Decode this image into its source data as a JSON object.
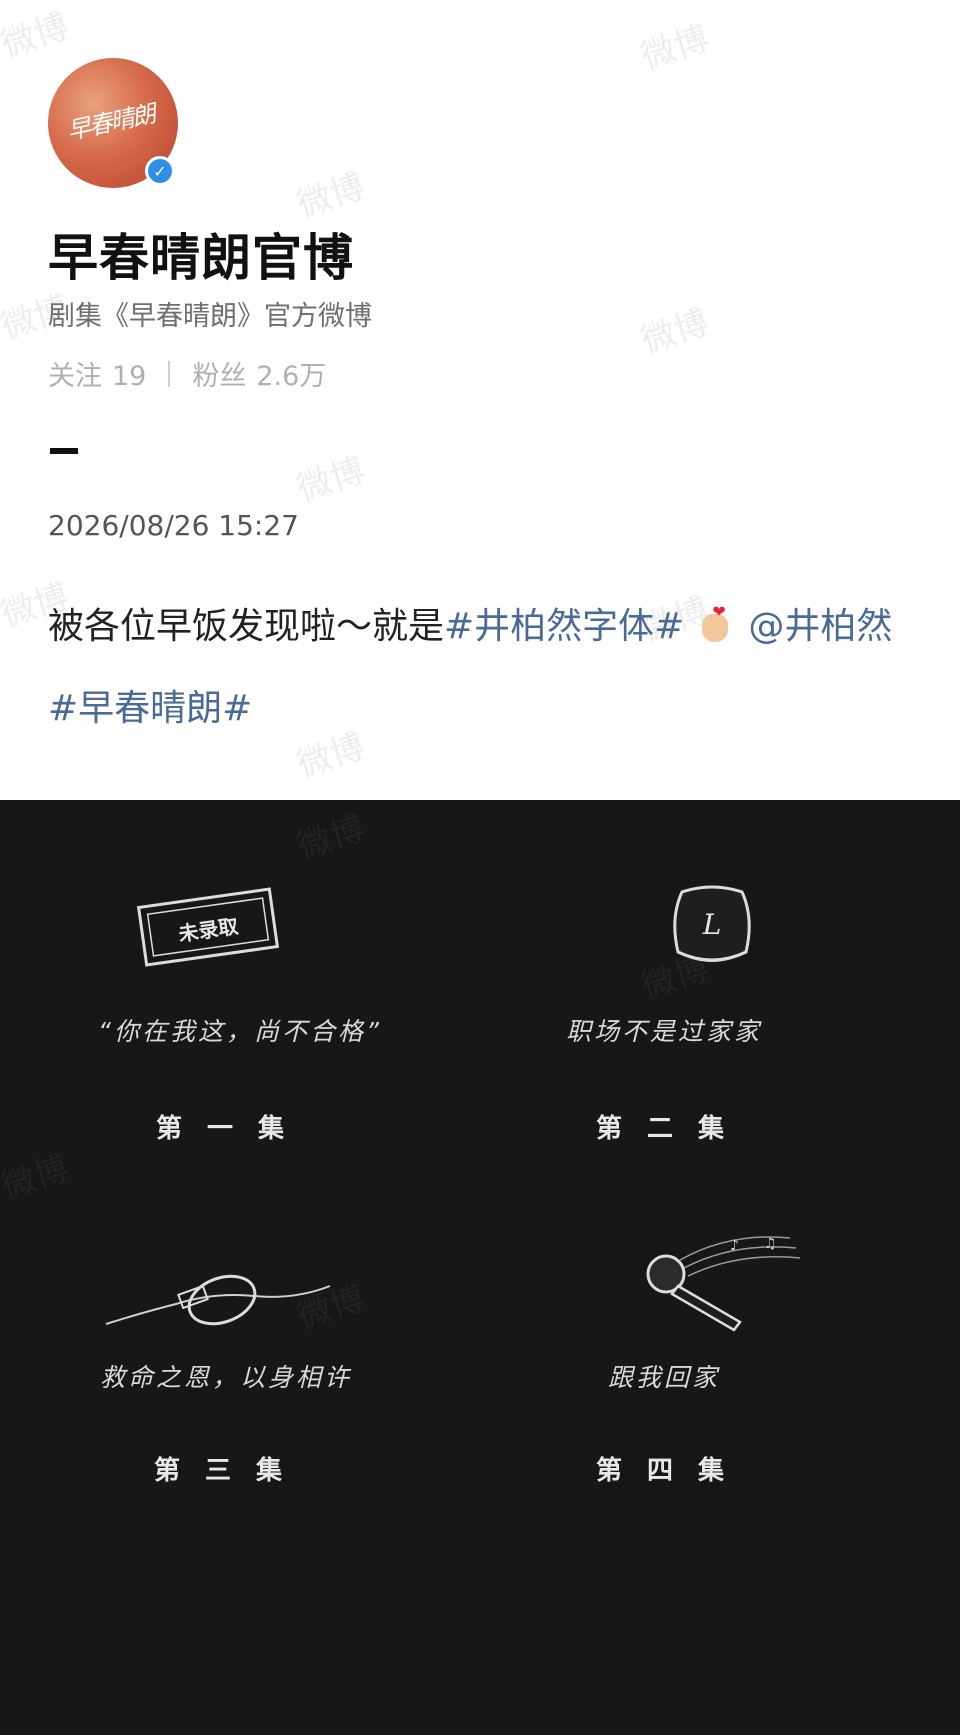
{
  "profile": {
    "avatar_text": "早春晴朗",
    "verified_icon": "verified-check-icon",
    "name": "早春晴朗官博",
    "bio": "剧集《早春晴朗》官方微博",
    "following_label": "关注",
    "following_count": "19",
    "followers_label": "粉丝",
    "followers_count": "2.6万"
  },
  "post": {
    "timestamp": "2026/08/26 15:27",
    "text_part1": "被各位早饭发现啦～就是",
    "topic1": "#井柏然字体#",
    "emoji_icon": "finger-heart-emoji-icon",
    "mention": "@井柏然",
    "topic2": "#早春晴朗#"
  },
  "watermark": "微博",
  "episodes": [
    {
      "icon": "stamp-icon",
      "stamp_text": "未录取",
      "phrase": "“你在我这，尚不合格”",
      "label": "第 一 集"
    },
    {
      "icon": "keycap-l-icon",
      "key_letter": "L",
      "phrase": "职场不是过家家",
      "label": "第 二 集"
    },
    {
      "icon": "cable-icon",
      "phrase": "救命之恩，以身相许",
      "label": "第 三 集"
    },
    {
      "icon": "microphone-icon",
      "phrase": "跟我回家",
      "label": "第 四 集"
    }
  ],
  "colors": {
    "topic_link": "#4c6a96",
    "verified_badge": "#2f8fe6",
    "dark_panel": "#161719"
  }
}
